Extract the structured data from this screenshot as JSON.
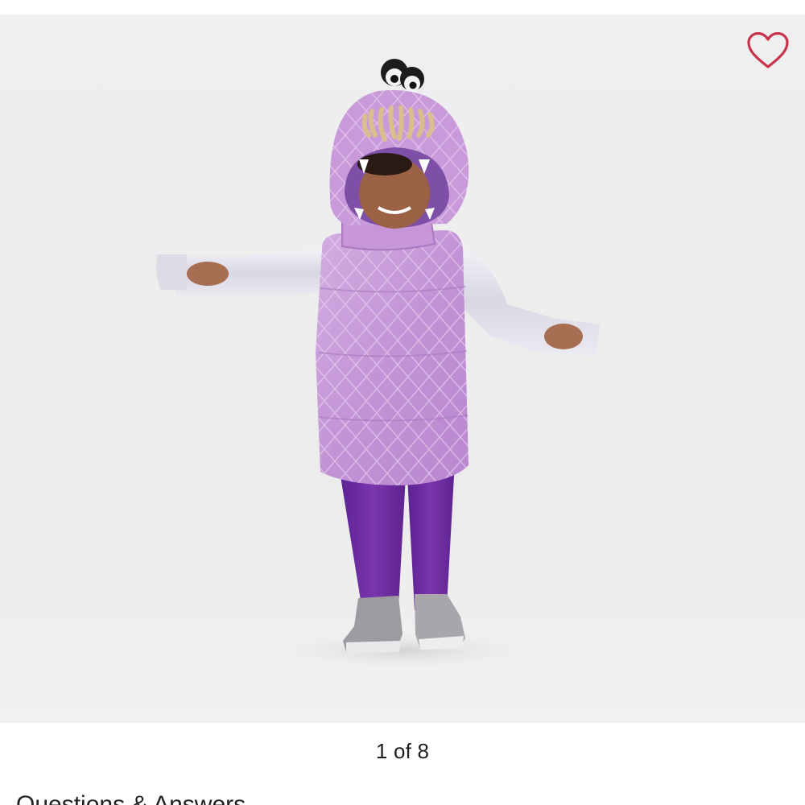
{
  "gallery": {
    "image_alt": "Child wearing a purple monster costume",
    "counter_text": "1 of 8",
    "favorite_icon": "heart-outline-icon"
  },
  "sections": {
    "qa_heading": "Questions & Answers"
  },
  "colors": {
    "heart": "#c9324a",
    "costume_purple": "#c79bd9",
    "leggings": "#6a2a9b",
    "sleeves": "#e3e1ea",
    "backdrop": "#eeeeef"
  }
}
